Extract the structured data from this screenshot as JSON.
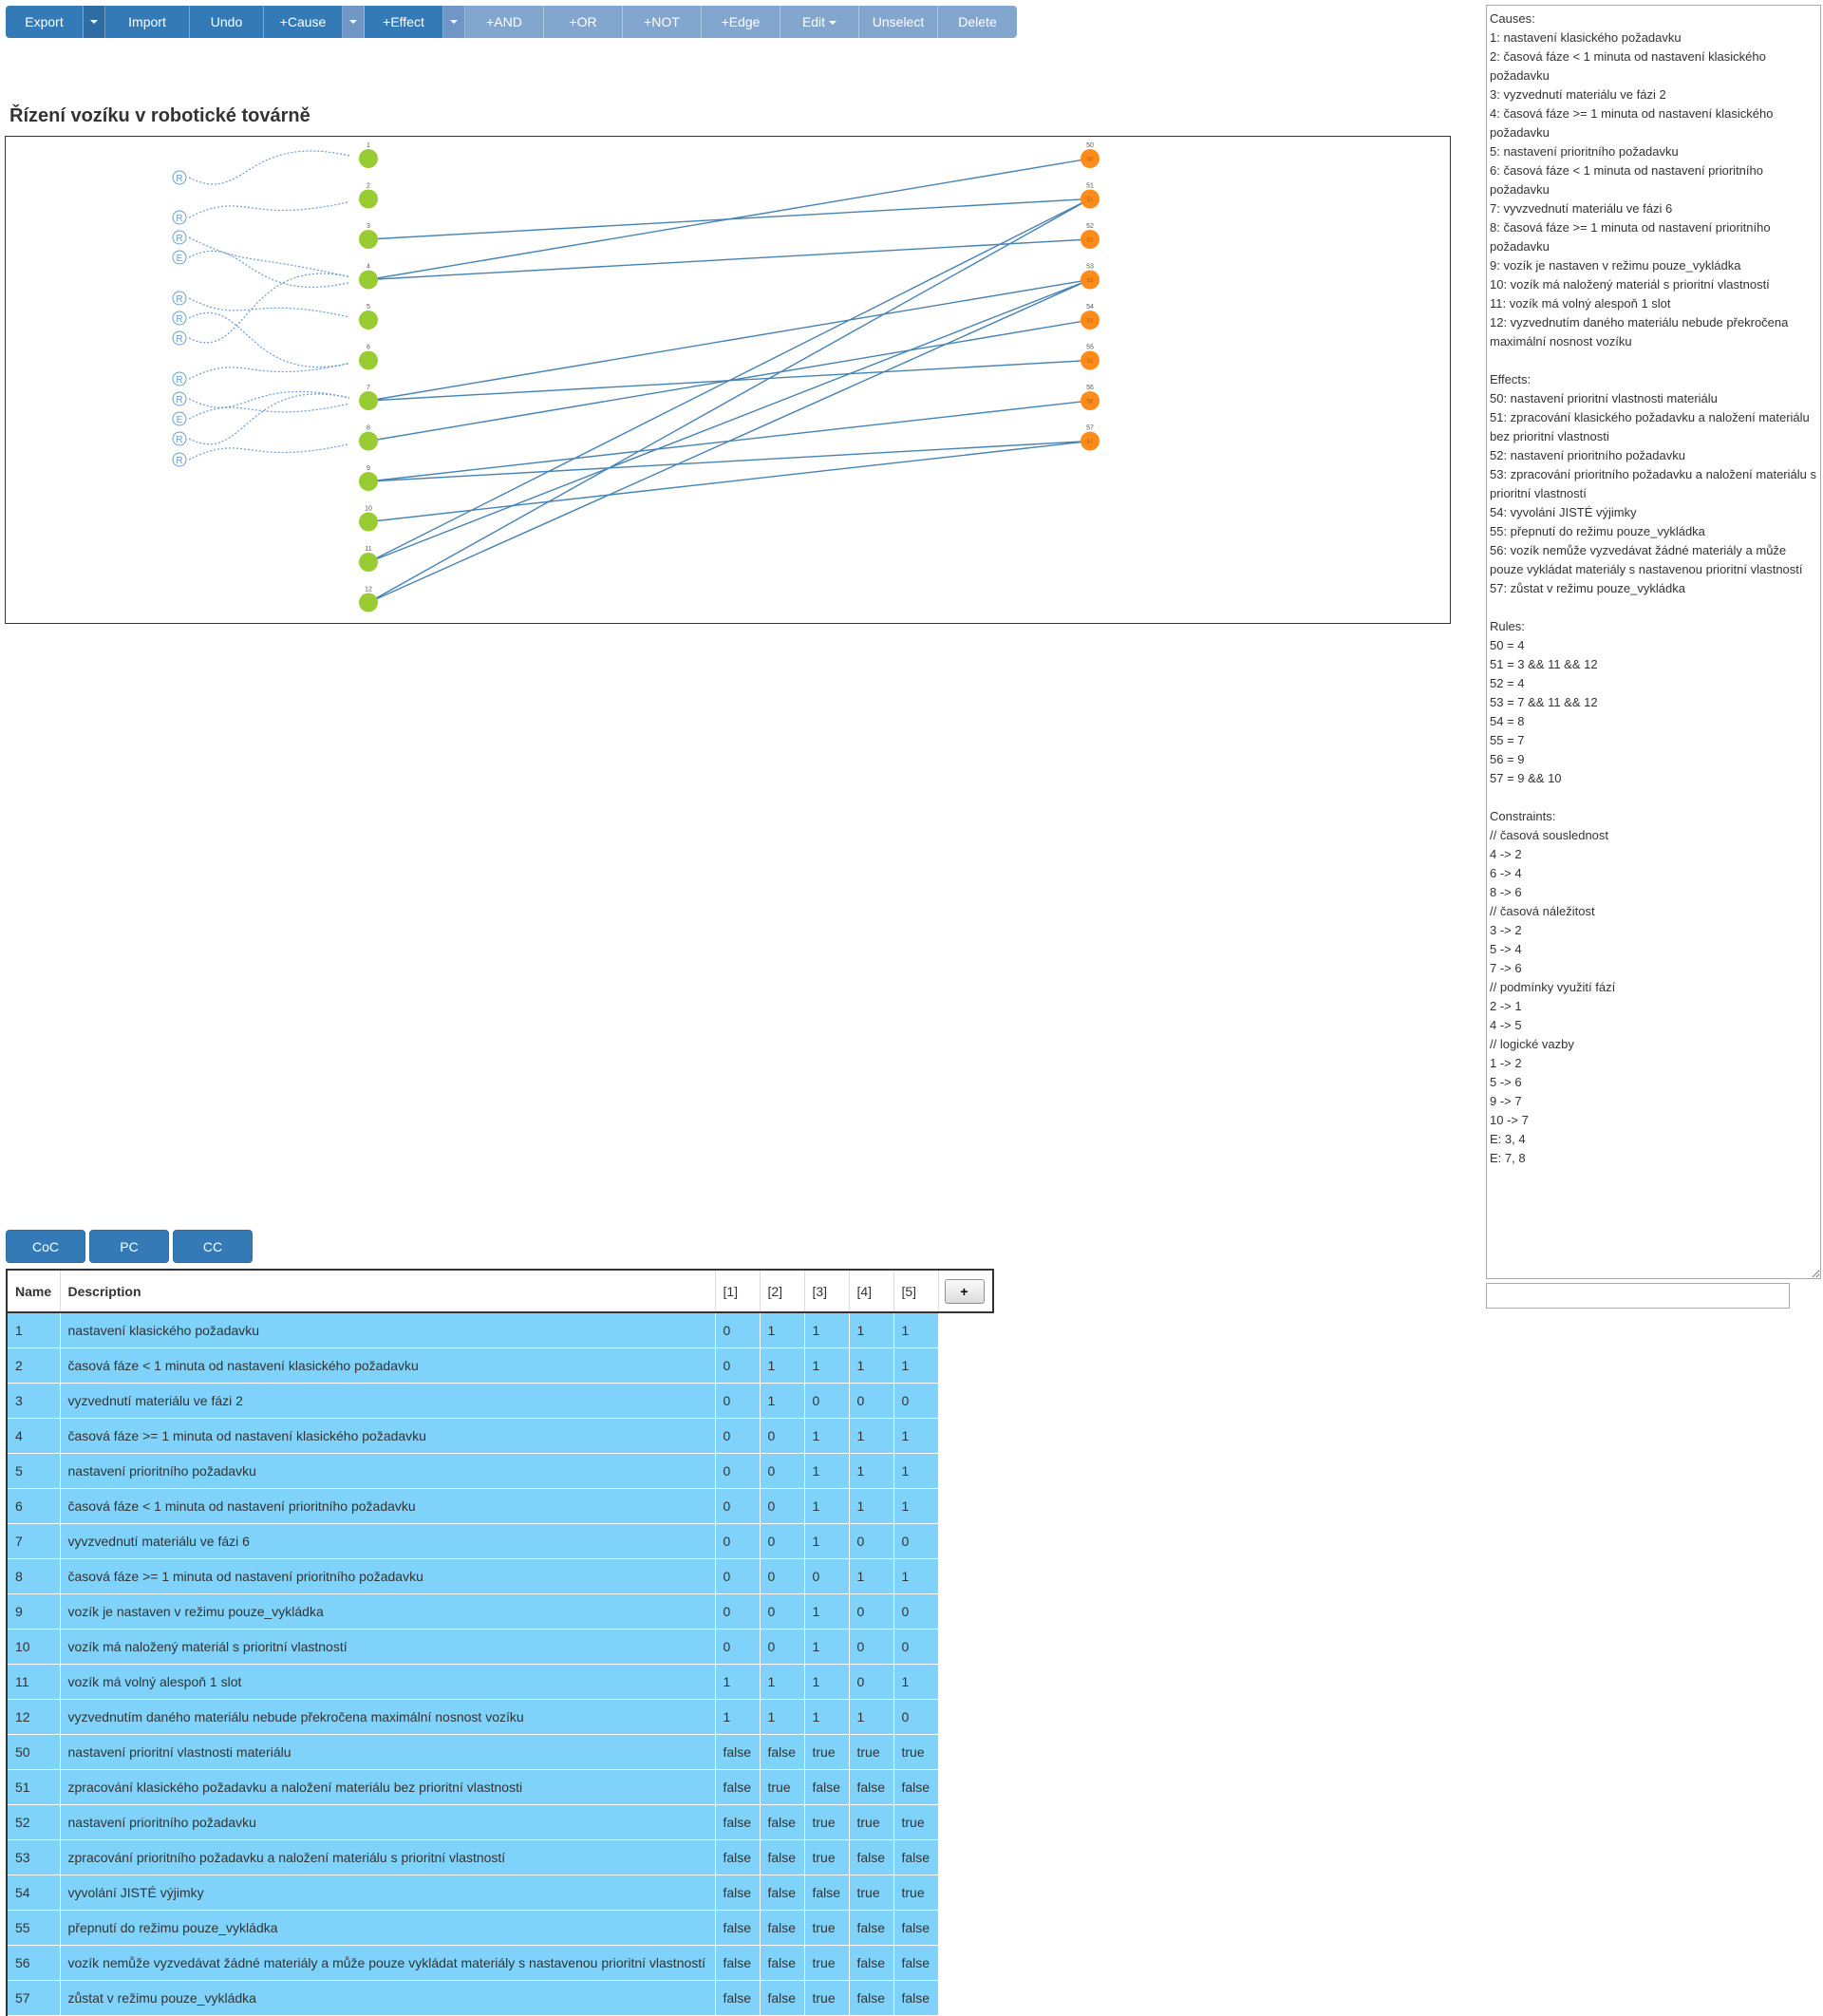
{
  "toolbar": {
    "export": "Export",
    "import": "Import",
    "undo": "Undo",
    "add_cause": "+Cause",
    "add_effect": "+Effect",
    "add_and": "+AND",
    "add_or": "+OR",
    "add_not": "+NOT",
    "add_edge": "+Edge",
    "edit": "Edit",
    "unselect": "Unselect",
    "delete": "Delete"
  },
  "graph": {
    "title": "Řízení vozíku v robotické továrně",
    "cause_nodes": [
      "1",
      "2",
      "3",
      "4",
      "5",
      "6",
      "7",
      "8",
      "9",
      "10",
      "11",
      "12"
    ],
    "effect_nodes": [
      "50",
      "51",
      "52",
      "53",
      "54",
      "55",
      "56",
      "57"
    ],
    "effect_node_inner": [
      "50",
      "51",
      "52",
      "53",
      "54",
      "55",
      "56",
      "57"
    ],
    "constraint_nodes": [
      "R",
      "R",
      "R",
      "E",
      "R",
      "R",
      "R",
      "R",
      "R",
      "E",
      "R",
      "R"
    ],
    "cause_color": "#99cc33",
    "effect_color": "#ff8c1a",
    "edge_color": "#4682b4",
    "constraint_color": "#6a9ccf",
    "edges": [
      [
        "4",
        "50"
      ],
      [
        "3",
        "51"
      ],
      [
        "11",
        "51"
      ],
      [
        "12",
        "51"
      ],
      [
        "4",
        "52"
      ],
      [
        "7",
        "53"
      ],
      [
        "11",
        "53"
      ],
      [
        "12",
        "53"
      ],
      [
        "8",
        "54"
      ],
      [
        "7",
        "55"
      ],
      [
        "9",
        "56"
      ],
      [
        "9",
        "57"
      ],
      [
        "10",
        "57"
      ]
    ]
  },
  "spec_text": "Causes:\n1: nastavení klasického požadavku\n2: časová fáze < 1 minuta od nastavení klasického požadavku\n3: vyzvednutí materiálu ve fázi 2\n4: časová fáze >= 1 minuta od nastavení klasického požadavku\n5: nastavení prioritního požadavku\n6: časová fáze < 1 minuta od nastavení prioritního požadavku\n7: vyvzvednutí materiálu ve fázi 6\n8: časová fáze >= 1 minuta od nastavení prioritního požadavku\n9: vozík je nastaven v režimu pouze_vykládka\n10: vozík má naložený materiál s prioritní vlastností\n11: vozík má volný alespoň 1 slot\n12: vyzvednutím daného materiálu nebude překročena maximální nosnost vozíku\n\nEffects:\n50: nastavení prioritní vlastnosti materiálu\n51: zpracování klasického požadavku a naložení materiálu bez prioritní vlastnosti\n52: nastavení prioritního požadavku\n53: zpracování prioritního požadavku a naložení materiálu s prioritní vlastností\n54: vyvolání JISTÉ výjimky\n55: přepnutí do režimu pouze_vykládka\n56: vozík nemůže vyzvedávat žádné materiály a může pouze vykládat materiály s nastavenou prioritní vlastností\n57: zůstat v režimu pouze_vykládka\n\nRules:\n50 = 4\n51 = 3 && 11 && 12\n52 = 4\n53 = 7 && 11 && 12\n54 = 8\n55 = 7\n56 = 9\n57 = 9 && 10\n\nConstraints:\n// časová souslednost\n4 -> 2\n6 -> 4\n8 -> 6\n// časová náležitost\n3 -> 2\n5 -> 4\n7 -> 6\n// podmínky využití fází\n2 -> 1\n4 -> 5\n// logické vazby\n1 -> 2\n5 -> 6\n9 -> 7\n10 -> 7\nE: 3, 4\nE: 7, 8",
  "command_input": {
    "value": ""
  },
  "tabs": {
    "coc": "CoC",
    "pc": "PC",
    "cc": "CC"
  },
  "table": {
    "headers": {
      "name": "Name",
      "description": "Description",
      "add": "+"
    },
    "columns": [
      "[1]",
      "[2]",
      "[3]",
      "[4]",
      "[5]"
    ],
    "rows": [
      {
        "name": "1",
        "desc": "nastavení klasického požadavku",
        "v": [
          "0",
          "1",
          "1",
          "1",
          "1"
        ]
      },
      {
        "name": "2",
        "desc": "časová fáze < 1 minuta od nastavení klasického požadavku",
        "v": [
          "0",
          "1",
          "1",
          "1",
          "1"
        ]
      },
      {
        "name": "3",
        "desc": "vyzvednutí materiálu ve fázi 2",
        "v": [
          "0",
          "1",
          "0",
          "0",
          "0"
        ]
      },
      {
        "name": "4",
        "desc": "časová fáze >= 1 minuta od nastavení klasického požadavku",
        "v": [
          "0",
          "0",
          "1",
          "1",
          "1"
        ]
      },
      {
        "name": "5",
        "desc": "nastavení prioritního požadavku",
        "v": [
          "0",
          "0",
          "1",
          "1",
          "1"
        ]
      },
      {
        "name": "6",
        "desc": "časová fáze < 1 minuta od nastavení prioritního požadavku",
        "v": [
          "0",
          "0",
          "1",
          "1",
          "1"
        ]
      },
      {
        "name": "7",
        "desc": "vyvzvednutí materiálu ve fázi 6",
        "v": [
          "0",
          "0",
          "1",
          "0",
          "0"
        ]
      },
      {
        "name": "8",
        "desc": "časová fáze >= 1 minuta od nastavení prioritního požadavku",
        "v": [
          "0",
          "0",
          "0",
          "1",
          "1"
        ]
      },
      {
        "name": "9",
        "desc": "vozík je nastaven v režimu pouze_vykládka",
        "v": [
          "0",
          "0",
          "1",
          "0",
          "0"
        ]
      },
      {
        "name": "10",
        "desc": "vozík má naložený materiál s prioritní vlastností",
        "v": [
          "0",
          "0",
          "1",
          "0",
          "0"
        ]
      },
      {
        "name": "11",
        "desc": "vozík má volný alespoň 1 slot",
        "v": [
          "1",
          "1",
          "1",
          "0",
          "1"
        ]
      },
      {
        "name": "12",
        "desc": "vyzvednutím daného materiálu nebude překročena maximální nosnost vozíku",
        "v": [
          "1",
          "1",
          "1",
          "1",
          "0"
        ]
      },
      {
        "name": "50",
        "desc": "nastavení prioritní vlastnosti materiálu",
        "v": [
          "false",
          "false",
          "true",
          "true",
          "true"
        ]
      },
      {
        "name": "51",
        "desc": "zpracování klasického požadavku a naložení materiálu bez prioritní vlastnosti",
        "v": [
          "false",
          "true",
          "false",
          "false",
          "false"
        ]
      },
      {
        "name": "52",
        "desc": "nastavení prioritního požadavku",
        "v": [
          "false",
          "false",
          "true",
          "true",
          "true"
        ]
      },
      {
        "name": "53",
        "desc": "zpracování prioritního požadavku a naložení materiálu s prioritní vlastností",
        "v": [
          "false",
          "false",
          "true",
          "false",
          "false"
        ]
      },
      {
        "name": "54",
        "desc": "vyvolání JISTÉ výjimky",
        "v": [
          "false",
          "false",
          "false",
          "true",
          "true"
        ]
      },
      {
        "name": "55",
        "desc": "přepnutí do režimu pouze_vykládka",
        "v": [
          "false",
          "false",
          "true",
          "false",
          "false"
        ]
      },
      {
        "name": "56",
        "desc": "vozík nemůže vyzvedávat žádné materiály a může pouze vykládat materiály s nastavenou prioritní vlastností",
        "v": [
          "false",
          "false",
          "true",
          "false",
          "false"
        ]
      },
      {
        "name": "57",
        "desc": "zůstat v režimu pouze_vykládka",
        "v": [
          "false",
          "false",
          "true",
          "false",
          "false"
        ]
      }
    ]
  }
}
